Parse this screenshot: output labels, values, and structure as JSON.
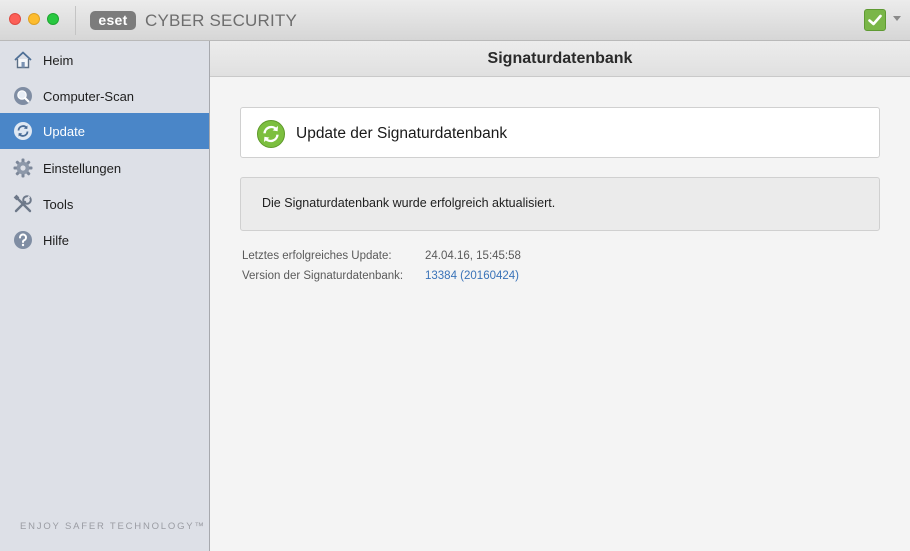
{
  "app": {
    "brand_logo": "eset",
    "brand_name": "CYBER SECURITY",
    "status_icon": "check-icon"
  },
  "sidebar": {
    "items": [
      {
        "label": "Heim",
        "icon": "home-icon",
        "active": false
      },
      {
        "label": "Computer-Scan",
        "icon": "magnifier-icon",
        "active": false
      },
      {
        "label": "Update",
        "icon": "refresh-icon",
        "active": true
      },
      {
        "label": "Einstellungen",
        "icon": "gear-icon",
        "active": false
      },
      {
        "label": "Tools",
        "icon": "tools-icon",
        "active": false
      },
      {
        "label": "Hilfe",
        "icon": "help-icon",
        "active": false
      }
    ],
    "slogan": "ENJOY SAFER TECHNOLOGY™"
  },
  "main": {
    "title": "Signaturdatenbank",
    "update_button_label": "Update der Signaturdatenbank",
    "status_message": "Die Signaturdatenbank wurde erfolgreich aktualisiert.",
    "info": {
      "last_update_label": "Letztes erfolgreiches Update:",
      "last_update_value": "24.04.16, 15:45:58",
      "version_label": "Version der Signaturdatenbank:",
      "version_value": "13384 (20160424)"
    }
  },
  "colors": {
    "accent": "#4a86c8",
    "success": "#7ab648",
    "link": "#3a73b8"
  }
}
